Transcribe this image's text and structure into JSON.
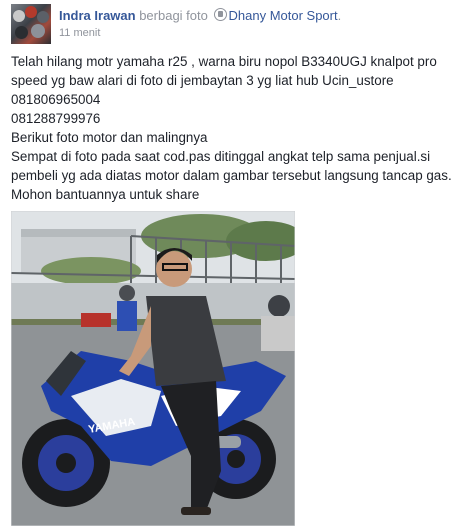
{
  "post": {
    "author": "Indra Irawan",
    "action": "berbagi foto",
    "page_name": "Dhany Motor Sport",
    "period": ".",
    "time": "11 menit",
    "lines": [
      "Telah hilang motr yamaha r25 , warna biru nopol B3340UGJ knalpot pro",
      "speed yg baw alari di foto di jembaytan 3 yg liat hub Ucin_ustore",
      "081806965004",
      "081288799976",
      "Berikut foto motor dan malingnya",
      "Sempat di foto pada saat cod.pas ditinggal angkat telp sama penjual.si",
      "pembeli yg ada diatas motor dalam gambar tersebut langsung tancap gas.",
      "Mohon bantuannya untuk share"
    ]
  },
  "photo": {
    "bike_brand": "YAMAHA",
    "colors": {
      "bike_blue": "#1f3fa8",
      "shirt": "#3a3c40",
      "sky": "#dfe3e6"
    }
  },
  "colors": {
    "link": "#365899",
    "meta": "#90949c",
    "text": "#1d2129"
  }
}
